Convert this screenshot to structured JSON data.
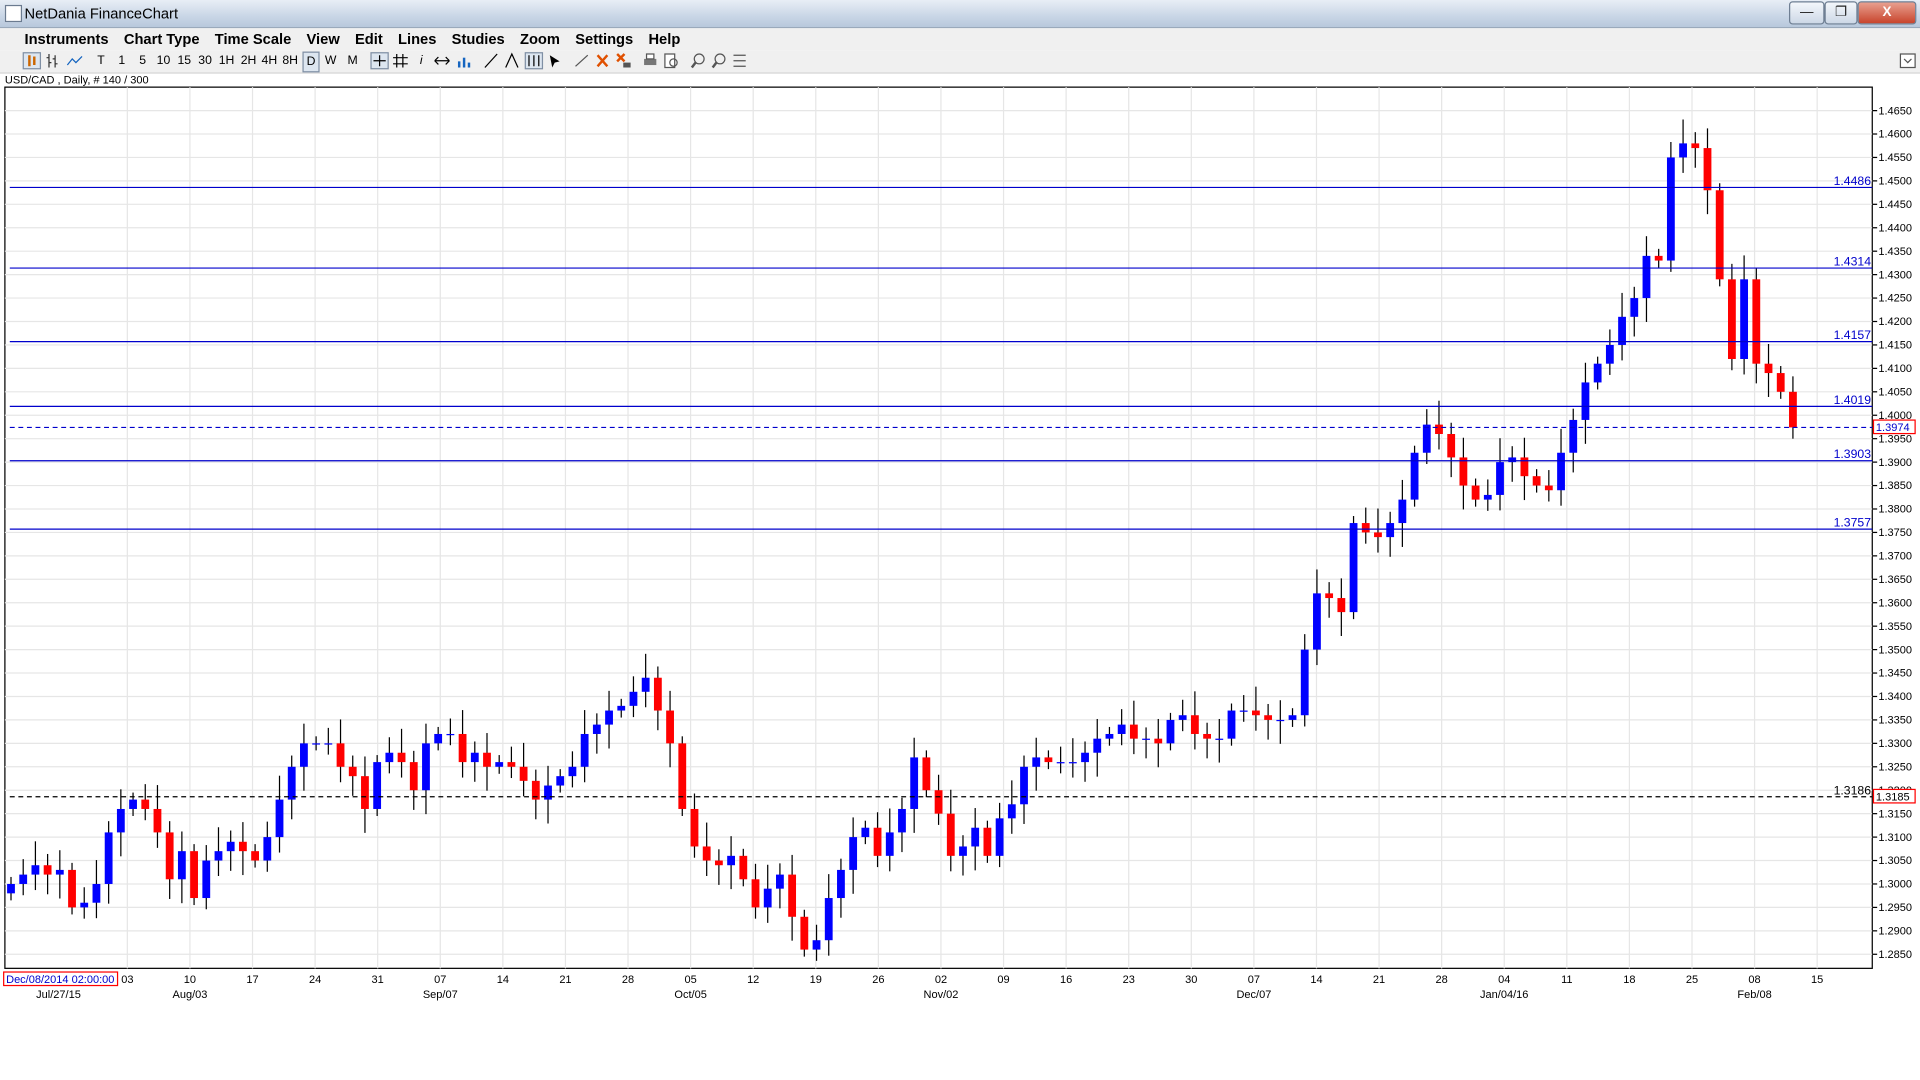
{
  "window": {
    "title": "NetDania FinanceChart",
    "controls": [
      "—",
      "❐",
      "X"
    ]
  },
  "menu": [
    "Instruments",
    "Chart Type",
    "Time Scale",
    "View",
    "Edit",
    "Lines",
    "Studies",
    "Zoom",
    "Settings",
    "Help"
  ],
  "toolbar": {
    "timeframes": [
      "T",
      "1",
      "5",
      "10",
      "15",
      "30",
      "1H",
      "2H",
      "4H",
      "8H",
      "D",
      "W",
      "M"
    ],
    "selected_timeframe": "D",
    "icons": [
      "bar-chart-icon",
      "ohlc-icon",
      "line-chart-icon",
      "crosshair-icon",
      "grid-icon",
      "info-icon",
      "scroll-icon",
      "volume-icon",
      "trendline-icon",
      "fibonacci-icon",
      "channel-icon",
      "cursor-icon",
      "draw-line-icon",
      "delete-icon",
      "delete-all-icon",
      "print-icon",
      "preview-icon",
      "zoom-in-icon",
      "zoom-out-icon",
      "zoom-fit-icon"
    ]
  },
  "symbol_label": "USD/CAD , Daily, # 140 / 300",
  "cursor_date_label": "Dec/08/2014 02:00:00",
  "colors": {
    "up": "#0000ff",
    "down": "#ff0000",
    "level_line": "#0000cc",
    "grid": "#e6e6e6",
    "wick": "#000000"
  },
  "chart_data": {
    "type": "candlestick",
    "symbol": "USD/CAD",
    "timeframe": "Daily",
    "ylim": [
      1.282,
      1.47
    ],
    "y_ticks": [
      "1.2850",
      "1.2900",
      "1.2950",
      "1.3000",
      "1.3050",
      "1.3100",
      "1.3150",
      "1.3200",
      "1.3250",
      "1.3300",
      "1.3350",
      "1.3400",
      "1.3450",
      "1.3500",
      "1.3550",
      "1.3600",
      "1.3650",
      "1.3700",
      "1.3750",
      "1.3800",
      "1.3850",
      "1.3900",
      "1.3950",
      "1.4000",
      "1.4050",
      "1.4100",
      "1.4150",
      "1.4200",
      "1.4250",
      "1.4300",
      "1.4350",
      "1.4400",
      "1.4450",
      "1.4500",
      "1.4550",
      "1.4600",
      "1.4650"
    ],
    "x_tick_labels": [
      "03",
      "10",
      "17",
      "24",
      "31",
      "07",
      "14",
      "21",
      "28",
      "05",
      "12",
      "19",
      "26",
      "02",
      "09",
      "16",
      "23",
      "30",
      "07",
      "14",
      "21",
      "28",
      "04",
      "11",
      "18",
      "25",
      "08",
      "15"
    ],
    "x_month_labels": [
      "Jul/27/15",
      "Aug/03",
      "Sep/07",
      "Oct/05",
      "Nov/02",
      "Dec/07",
      "Jan/04/16",
      "Feb/08"
    ],
    "horizontal_levels": [
      "1.4486",
      "1.4314",
      "1.4157",
      "1.4019",
      "1.3903",
      "1.3757"
    ],
    "current_price": "1.3974",
    "reference_price_left": "1.3186",
    "reference_price_right": "1.3185",
    "closes": [
      1.3,
      1.302,
      1.304,
      1.302,
      1.303,
      1.295,
      1.296,
      1.3,
      1.311,
      1.316,
      1.318,
      1.316,
      1.311,
      1.301,
      1.307,
      1.297,
      1.305,
      1.307,
      1.309,
      1.307,
      1.305,
      1.31,
      1.318,
      1.325,
      1.33,
      1.33,
      1.33,
      1.325,
      1.323,
      1.316,
      1.326,
      1.328,
      1.326,
      1.32,
      1.33,
      1.332,
      1.332,
      1.326,
      1.328,
      1.325,
      1.326,
      1.325,
      1.322,
      1.318,
      1.321,
      1.323,
      1.325,
      1.332,
      1.334,
      1.337,
      1.338,
      1.341,
      1.344,
      1.337,
      1.33,
      1.316,
      1.308,
      1.305,
      1.304,
      1.306,
      1.301,
      1.295,
      1.299,
      1.302,
      1.293,
      1.286,
      1.288,
      1.297,
      1.303,
      1.31,
      1.312,
      1.306,
      1.311,
      1.316,
      1.327,
      1.32,
      1.315,
      1.306,
      1.308,
      1.312,
      1.306,
      1.314,
      1.317,
      1.325,
      1.327,
      1.326,
      1.326,
      1.326,
      1.328,
      1.331,
      1.332,
      1.334,
      1.331,
      1.331,
      1.33,
      1.335,
      1.336,
      1.332,
      1.331,
      1.331,
      1.337,
      1.337,
      1.336,
      1.335,
      1.335,
      1.336,
      1.35,
      1.362,
      1.361,
      1.358,
      1.377,
      1.375,
      1.374,
      1.377,
      1.382,
      1.392,
      1.398,
      1.396,
      1.391,
      1.385,
      1.382,
      1.383,
      1.39,
      1.391,
      1.387,
      1.385,
      1.384,
      1.392,
      1.399,
      1.407,
      1.411,
      1.415,
      1.421,
      1.425,
      1.434,
      1.433,
      1.455,
      1.458,
      1.457,
      1.448,
      1.429,
      1.412,
      1.429,
      1.411,
      1.409,
      1.405,
      1.3974
    ],
    "max_bars": 153
  }
}
